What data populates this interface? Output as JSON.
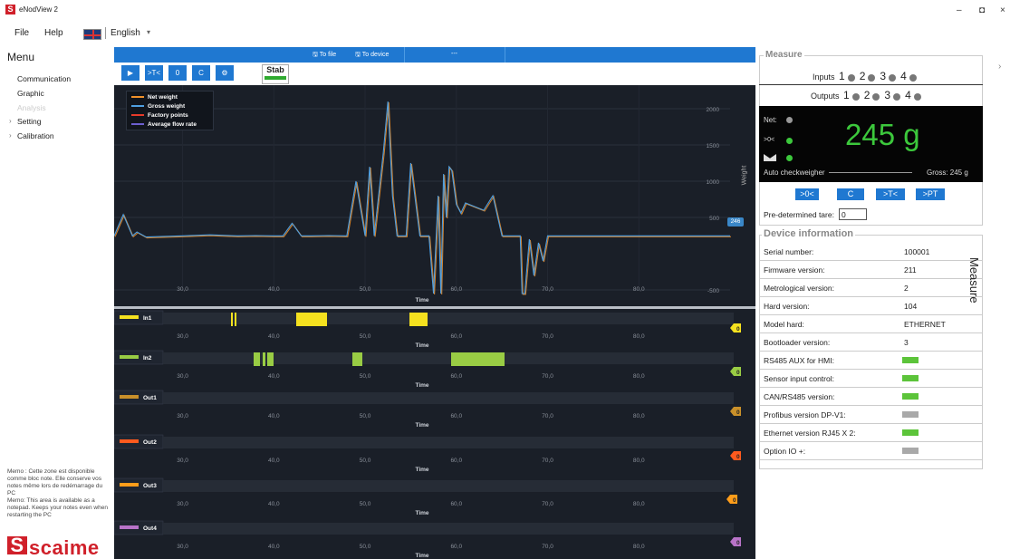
{
  "window": {
    "title": "eNodView 2",
    "minimize": "–",
    "restore": "◘",
    "close": "×"
  },
  "menubar": {
    "file": "File",
    "help": "Help",
    "language": "English",
    "lang_arrow": "▾"
  },
  "sidebar": {
    "heading": "Menu",
    "items": [
      {
        "label": "Communication"
      },
      {
        "label": "Graphic"
      },
      {
        "label": "Analysis"
      },
      {
        "label": "Setting",
        "prefix": "›"
      },
      {
        "label": "Calibration",
        "prefix": "›"
      }
    ],
    "memo": "Memo : Cette zone est disponible comme bloc note. Elle conserve vos notes même lors de redémarrage du PC\nMemo: This area is available as a notepad. Keeps your notes even when restarting the PC",
    "brand": "scaime"
  },
  "graph": {
    "to_file": "To file",
    "to_device": "To device",
    "slot": "---",
    "buttons": {
      "play": "▶",
      "tare": ">T<",
      "zero": "0",
      "clear": "C",
      "settings": "⚙"
    },
    "stab": "Stab",
    "legend": [
      {
        "label": "Net weight",
        "color": "#f0912a"
      },
      {
        "label": "Gross weight",
        "color": "#4f9fe0"
      },
      {
        "label": "Factory points",
        "color": "#e63a2a"
      },
      {
        "label": "Average flow rate",
        "color": "#6d5fd0"
      }
    ],
    "y_axis_label": "Weight",
    "current_value": "246",
    "x_axis_label": "Time"
  },
  "chart_data": {
    "type": "line",
    "xlabel": "Time",
    "ylabel": "Weight",
    "x_ticks": [
      "30,0",
      "40,0",
      "50,0",
      "60,0",
      "70,0",
      "80,0"
    ],
    "y_ticks": [
      "2000",
      "1500",
      "1000",
      "500",
      "-500"
    ],
    "ylim": [
      -650,
      2150
    ],
    "xlim": [
      22.5,
      90
    ],
    "series": [
      {
        "name": "Net weight",
        "color": "#f0912a"
      },
      {
        "name": "Gross weight",
        "color": "#4f9fe0",
        "x": [
          22.5,
          23.5,
          24.5,
          25,
          26,
          30,
          33,
          36,
          38,
          40,
          41,
          42,
          43,
          44,
          46,
          48,
          49,
          50,
          50.5,
          51,
          52,
          52.5,
          53,
          53.5,
          54,
          54.5,
          55,
          56,
          57,
          57.5,
          58,
          58.3,
          58.6,
          58.9,
          59.2,
          59.5,
          60,
          60.5,
          61,
          62,
          63,
          64,
          65,
          66,
          67,
          67.2,
          67.5,
          68,
          68.5,
          69,
          69.5,
          70,
          70.5,
          71,
          72,
          73,
          74,
          75,
          80,
          85,
          90
        ],
        "y": [
          246,
          540,
          246,
          300,
          230,
          246,
          260,
          246,
          250,
          246,
          246,
          420,
          246,
          246,
          250,
          246,
          1000,
          246,
          1200,
          246,
          1400,
          2100,
          800,
          246,
          246,
          246,
          1250,
          246,
          246,
          -550,
          800,
          -550,
          1100,
          500,
          1200,
          1150,
          680,
          560,
          700,
          650,
          600,
          800,
          246,
          246,
          246,
          -550,
          -550,
          200,
          -300,
          150,
          -100,
          246,
          246,
          246,
          246,
          246,
          246,
          246,
          246,
          246,
          246
        ]
      }
    ]
  },
  "channels": [
    {
      "label": "In1",
      "color": "#f5e11f",
      "badge": "0"
    },
    {
      "label": "In2",
      "color": "#99cc44",
      "badge": "0"
    },
    {
      "label": "Out1",
      "color": "#c9902a",
      "badge": "0"
    },
    {
      "label": "Out2",
      "color": "#ff5a1e",
      "badge": "0"
    },
    {
      "label": "Out3",
      "color": "#ff9d1a",
      "badge": "0"
    },
    {
      "label": "Out4",
      "color": "#b873c8",
      "badge": "0"
    }
  ],
  "measure": {
    "heading": "Measure",
    "inputs_label": "Inputs",
    "outputs_label": "Outputs",
    "io_numbers": [
      "1",
      "2",
      "3",
      "4"
    ],
    "net_label": "Net:",
    "zero_label": ">0<",
    "weight": "245 g",
    "auto_checkweigher": "Auto checkweigher",
    "gross": "Gross:  245  g",
    "buttons": [
      ">0<",
      "C",
      ">T<",
      ">PT"
    ],
    "tare_label": "Pre-determined tare:",
    "tare_value": "0",
    "side_tab": "Measure",
    "side_arrow": "›"
  },
  "device": {
    "heading": "Device information",
    "rows": [
      {
        "key": "Serial number:",
        "value": "100001"
      },
      {
        "key": "Firmware version:",
        "value": "211"
      },
      {
        "key": "Metrological version:",
        "value": "2"
      },
      {
        "key": "Hard version:",
        "value": "104"
      },
      {
        "key": "Model hard:",
        "value": "ETHERNET"
      },
      {
        "key": "Bootloader version:",
        "value": "3"
      },
      {
        "key": "RS485 AUX for HMI:",
        "status": "on"
      },
      {
        "key": "Sensor input control:",
        "status": "on"
      },
      {
        "key": "CAN/RS485 version:",
        "status": "on"
      },
      {
        "key": "Profibus version DP-V1:",
        "status": "off"
      },
      {
        "key": "Ethernet version RJ45 X 2:",
        "status": "on"
      },
      {
        "key": "Option IO +:",
        "status": "off"
      }
    ],
    "on_color": "#5cc43a",
    "off_color": "#a9a9a9"
  }
}
